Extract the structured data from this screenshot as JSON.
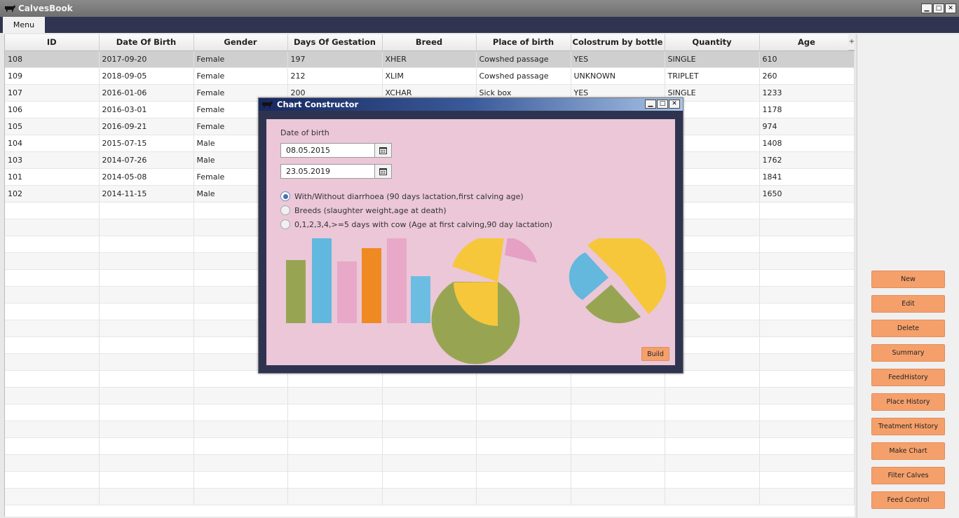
{
  "window": {
    "title": "CalvesBook"
  },
  "menu": {
    "items": [
      "Menu"
    ]
  },
  "table": {
    "columns": [
      "ID",
      "Date Of Birth",
      "Gender",
      "Days Of Gestation",
      "Breed",
      "Place of birth",
      "Colostrum by bottle",
      "Quantity",
      "Age"
    ],
    "rows": [
      [
        "108",
        "2017-09-20",
        "Female",
        "197",
        "XHER",
        "Cowshed passage",
        "YES",
        "SINGLE",
        "610"
      ],
      [
        "109",
        "2018-09-05",
        "Female",
        "212",
        "XLIM",
        "Cowshed passage",
        "UNKNOWN",
        "TRIPLET",
        "260"
      ],
      [
        "107",
        "2016-01-06",
        "Female",
        "200",
        "XCHAR",
        "Sick box",
        "YES",
        "SINGLE",
        "1233"
      ],
      [
        "106",
        "2016-03-01",
        "Female",
        "",
        "",
        "",
        "",
        "LE",
        "1178"
      ],
      [
        "105",
        "2016-09-21",
        "Female",
        "",
        "",
        "",
        "",
        "N",
        "974"
      ],
      [
        "104",
        "2015-07-15",
        "Male",
        "",
        "",
        "",
        "",
        "LE",
        "1408"
      ],
      [
        "103",
        "2014-07-26",
        "Male",
        "",
        "",
        "",
        "",
        "LET",
        "1762"
      ],
      [
        "101",
        "2014-05-08",
        "Female",
        "",
        "",
        "",
        "",
        "LE",
        "1841"
      ],
      [
        "102",
        "2014-11-15",
        "Male",
        "",
        "",
        "",
        "",
        "N",
        "1650"
      ]
    ],
    "corner_symbol": "+"
  },
  "side_buttons": [
    "New",
    "Edit",
    "Delete",
    "Summary",
    "FeedHistory",
    "Place History",
    "Treatment History",
    "Make Chart",
    "Filter Calves",
    "Feed Control"
  ],
  "dialog": {
    "title": "Chart Constructor",
    "section_label": "Date of birth",
    "date_from": "08.05.2015",
    "date_to": "23.05.2019",
    "options": [
      {
        "label": "With/Without diarrhoea (90 days lactation,first calving age)",
        "checked": true
      },
      {
        "label": "Breeds (slaughter weight,age at death)",
        "checked": false
      },
      {
        "label": "0,1,2,3,4,>=5 days with cow (Age at first calving,90 day lactation)",
        "checked": false
      }
    ],
    "build_label": "Build"
  },
  "colors": {
    "menubar": "#2f3550",
    "accent_button": "#f5a06b",
    "dialog_body": "#ebc7d8"
  }
}
